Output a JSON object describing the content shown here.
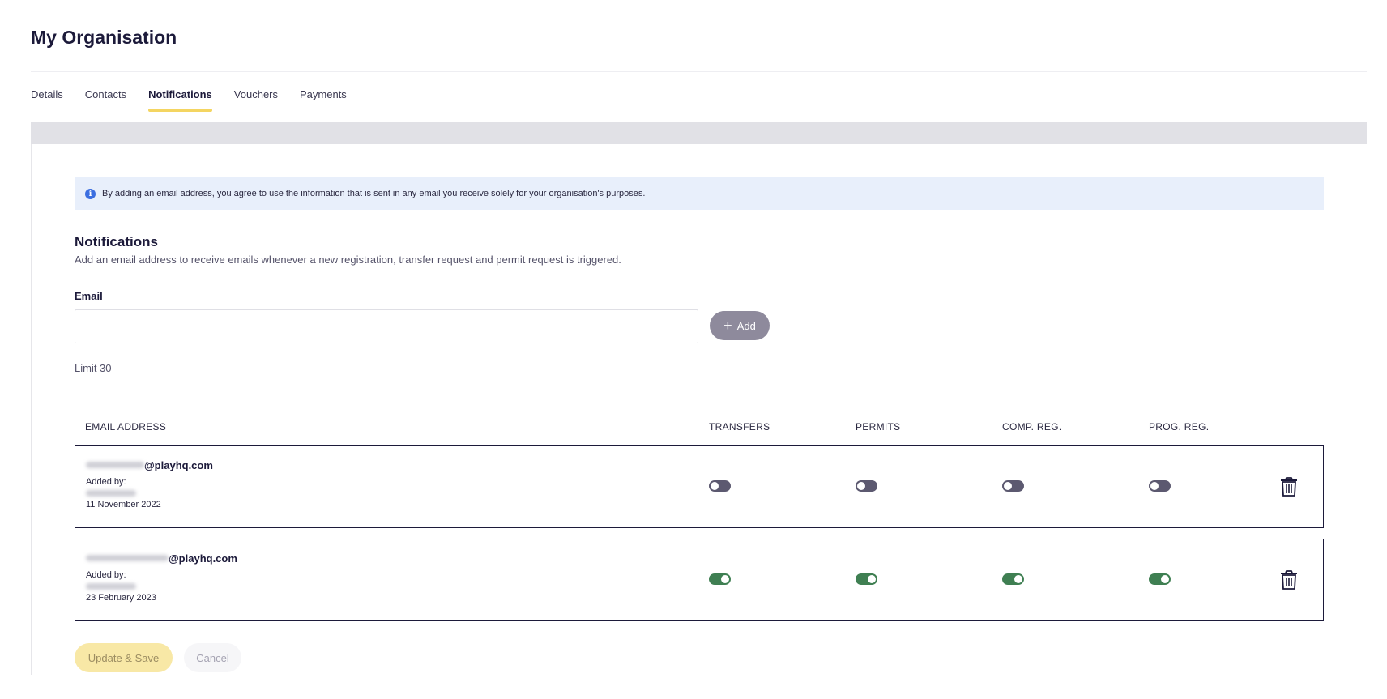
{
  "page": {
    "title": "My Organisation"
  },
  "tabs": [
    {
      "label": "Details",
      "active": false
    },
    {
      "label": "Contacts",
      "active": false
    },
    {
      "label": "Notifications",
      "active": true
    },
    {
      "label": "Vouchers",
      "active": false
    },
    {
      "label": "Payments",
      "active": false
    }
  ],
  "info_banner": {
    "icon": "info-icon",
    "icon_glyph": "i",
    "text": "By adding an email address, you agree to use the information that is sent in any email you receive solely for your organisation's purposes."
  },
  "notifications": {
    "title": "Notifications",
    "description": "Add an email address to receive emails whenever a new registration, transfer request and permit request is triggered.",
    "email_label": "Email",
    "email_value": "",
    "email_placeholder": "",
    "add_button_label": "Add",
    "add_icon": "plus-icon",
    "limit_text": "Limit 30"
  },
  "table": {
    "headers": {
      "email": "EMAIL ADDRESS",
      "transfers": "TRANSFERS",
      "permits": "PERMITS",
      "comp_reg": "COMP. REG.",
      "prog_reg": "PROG. REG."
    },
    "rows": [
      {
        "email_domain": "@playhq.com",
        "added_by_label": "Added by:",
        "date": "11 November 2022",
        "transfers": false,
        "permits": false,
        "comp_reg": false,
        "prog_reg": false,
        "delete_icon": "trash-icon"
      },
      {
        "email_domain": "@playhq.com",
        "added_by_label": "Added by:",
        "date": "23 February 2023",
        "transfers": true,
        "permits": true,
        "comp_reg": true,
        "prog_reg": true,
        "delete_icon": "trash-icon"
      }
    ]
  },
  "actions": {
    "update_label": "Update & Save",
    "cancel_label": "Cancel"
  },
  "colors": {
    "accent": "#f4d561",
    "toggle_on": "#3f7f52",
    "toggle_off": "#5c5970",
    "info_bg": "#e8effb",
    "info_icon": "#3b6ee0"
  }
}
